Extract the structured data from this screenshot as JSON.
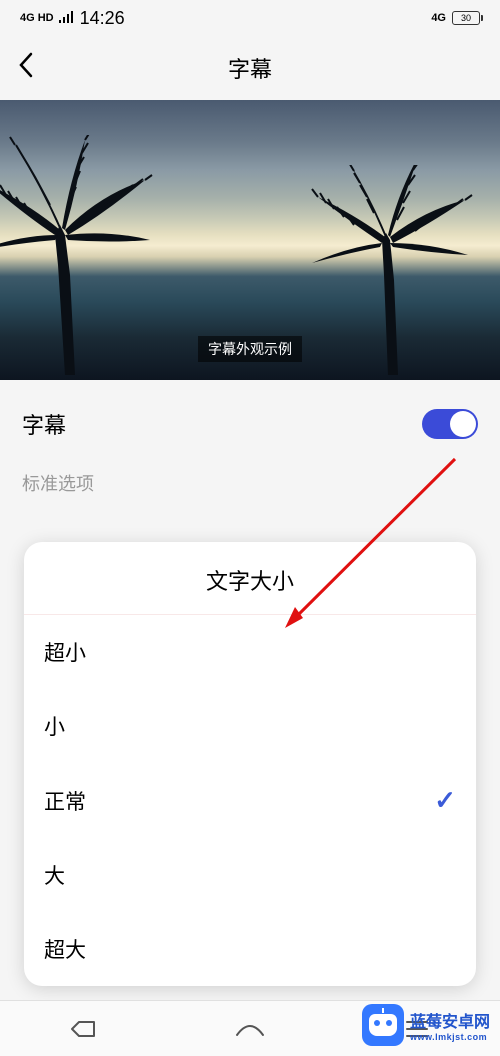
{
  "status": {
    "signal": "4G HD",
    "time": "14:26",
    "network": "4G",
    "battery": "30"
  },
  "header": {
    "title": "字幕"
  },
  "preview": {
    "subtitle_example": "字幕外观示例"
  },
  "settings": {
    "subtitle_label": "字幕",
    "subtitle_enabled": true,
    "section_label": "标准选项"
  },
  "popup": {
    "title": "文字大小",
    "options": [
      {
        "label": "超小",
        "selected": false
      },
      {
        "label": "小",
        "selected": false
      },
      {
        "label": "正常",
        "selected": true
      },
      {
        "label": "大",
        "selected": false
      },
      {
        "label": "超大",
        "selected": false
      }
    ]
  },
  "watermark": {
    "main": "蓝莓安卓网",
    "sub": "www.lmkjst.com"
  }
}
